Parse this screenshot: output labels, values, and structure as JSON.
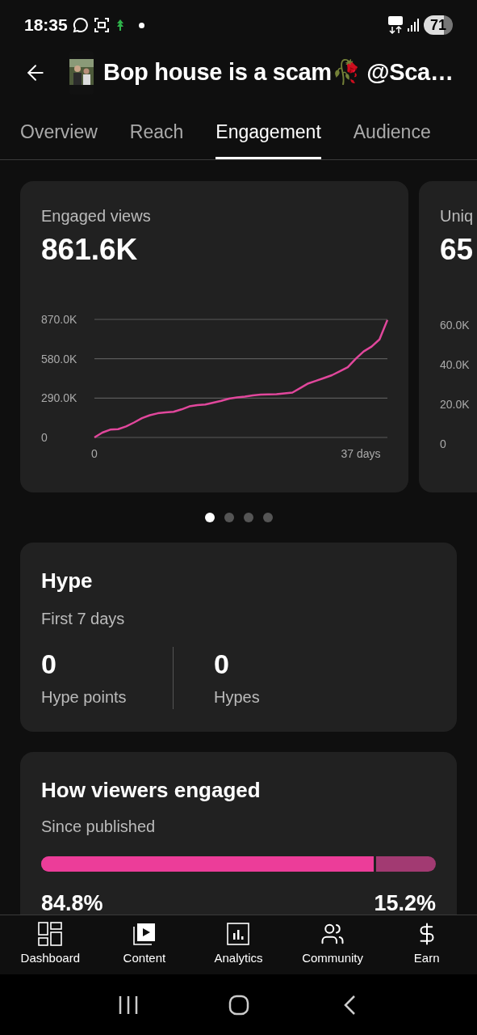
{
  "status_bar": {
    "time": "18:35",
    "battery": "71"
  },
  "header": {
    "title": "Bop house is a scam🥀 @Sca…"
  },
  "tabs": [
    {
      "label": "Overview",
      "selected": false
    },
    {
      "label": "Reach",
      "selected": false
    },
    {
      "label": "Engagement",
      "selected": true
    },
    {
      "label": "Audience",
      "selected": false
    }
  ],
  "metric_cards": [
    {
      "title": "Engaged views",
      "value": "861.6K",
      "chart_data": {
        "type": "line",
        "x": [
          0,
          1.1,
          2.2,
          3.3,
          4.4,
          5.5,
          6.6,
          7.7,
          8.8,
          9.9,
          11,
          12.1,
          13.2,
          14.3,
          15.4,
          16.5,
          17.6,
          18.7,
          19.8,
          20.9,
          22,
          23.1,
          24.2,
          25.3,
          26.4,
          27.5,
          28.6,
          29.7,
          30.8,
          31.9,
          33,
          34.1,
          35.2,
          36.3,
          37.4,
          38.5,
          39.6,
          40.7
        ],
        "series": [
          {
            "color": "#e1479c",
            "values": [
              0,
              36000,
              58000,
              61000,
              81000,
              110000,
              142000,
              164000,
              178000,
              184000,
              189000,
              207000,
              229000,
              238000,
              243000,
              256000,
              270000,
              286000,
              295000,
              301000,
              310000,
              315000,
              317000,
              319000,
              324000,
              331000,
              364000,
              398000,
              418000,
              438000,
              459000,
              488000,
              517000,
              580000,
              634000,
              670000,
              722000,
              866000
            ]
          }
        ],
        "xlim": [
          0,
          40.7
        ],
        "ylim": [
          0,
          870000
        ],
        "xticks": [
          {
            "value": 0,
            "label": "0"
          },
          {
            "value": 37,
            "label": "37 days"
          }
        ],
        "yticks": [
          {
            "value": 0,
            "label": "0"
          },
          {
            "value": 290000,
            "label": "290.0K"
          },
          {
            "value": 580000,
            "label": "580.0K"
          },
          {
            "value": 870000,
            "label": "870.0K"
          }
        ]
      }
    },
    {
      "title": "Uniq",
      "value": "65",
      "ytick_labels": [
        "60.0K",
        "40.0K",
        "20.0K",
        "0"
      ]
    }
  ],
  "carousel_dots": [
    {
      "selected": true
    },
    {
      "selected": false
    },
    {
      "selected": false
    },
    {
      "selected": false
    }
  ],
  "hype": {
    "title": "Hype",
    "subtitle": "First 7 days",
    "stats": [
      {
        "value": "0",
        "label": "Hype points"
      },
      {
        "value": "0",
        "label": "Hypes"
      }
    ]
  },
  "engagement": {
    "title": "How viewers engaged",
    "subtitle": "Since published",
    "level": 0.848,
    "segments": [
      {
        "color": "#ec3d99",
        "percent": "84.8%"
      },
      {
        "color": "#a23a72",
        "percent": "15.2%"
      }
    ]
  },
  "bottom_nav": [
    {
      "kind": "dashboard",
      "label": "Dashboard"
    },
    {
      "kind": "content",
      "label": "Content"
    },
    {
      "kind": "analytics",
      "label": "Analytics"
    },
    {
      "kind": "community",
      "label": "Community"
    },
    {
      "kind": "earn",
      "label": "Earn"
    }
  ]
}
